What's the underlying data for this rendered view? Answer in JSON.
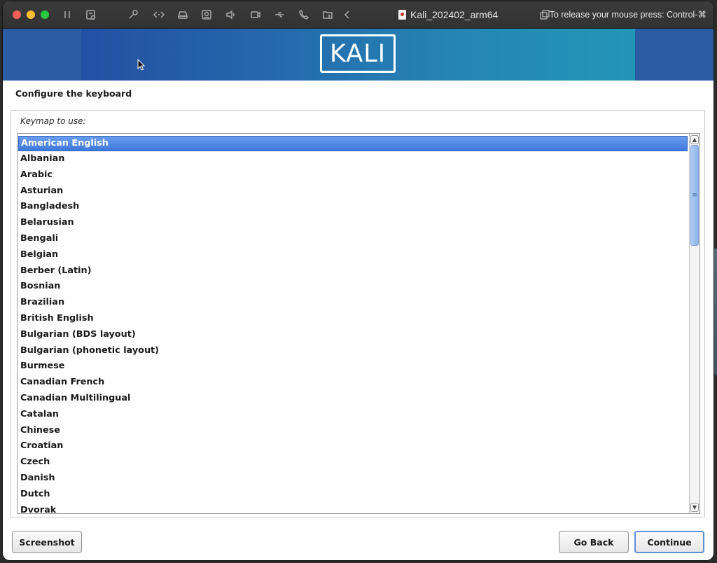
{
  "titlebar": {
    "vm_title": "Kali_202402_arm64",
    "release_hint": "To release your mouse press: Control-⌘",
    "icons": [
      "pause-icon",
      "snapshot-icon",
      "wrench-icon",
      "code-brackets-icon",
      "hard-drive-icon",
      "camera-icon",
      "sound-icon",
      "video-camera-icon",
      "usb-icon",
      "phone-icon",
      "shared-folder-icon",
      "back-chevron-icon",
      "window-tile-icon"
    ]
  },
  "banner": {
    "logo_text": "KALI"
  },
  "page": {
    "title": "Configure the keyboard",
    "keymap_label": "Keymap to use:"
  },
  "keymaps": [
    "American English",
    "Albanian",
    "Arabic",
    "Asturian",
    "Bangladesh",
    "Belarusian",
    "Bengali",
    "Belgian",
    "Berber (Latin)",
    "Bosnian",
    "Brazilian",
    "British English",
    "Bulgarian (BDS layout)",
    "Bulgarian (phonetic layout)",
    "Burmese",
    "Canadian French",
    "Canadian Multilingual",
    "Catalan",
    "Chinese",
    "Croatian",
    "Czech",
    "Danish",
    "Dutch",
    "Dvorak"
  ],
  "selected_keymap": "American English",
  "buttons": {
    "screenshot": "Screenshot",
    "go_back": "Go Back",
    "continue": "Continue"
  },
  "colors": {
    "selection": "#3d78dc",
    "banner_start": "#2350a3",
    "banner_end": "#2296b8"
  }
}
